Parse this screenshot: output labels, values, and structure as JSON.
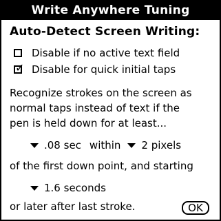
{
  "dialog": {
    "title": "Write Anywhere Tuning",
    "heading": "Auto-Detect Screen Writing:"
  },
  "checkboxes": [
    {
      "label": "Disable if no active text field",
      "checked": false
    },
    {
      "label": "Disable for quick initial taps",
      "checked": true,
      "mark": "✓"
    }
  ],
  "description": {
    "line1": "Recognize strokes on the screen as",
    "line2": "normal taps instead of text if the",
    "line3": "pen is held down for at least...",
    "line4": "of the first down point, and starting",
    "line5": "or later after last stroke."
  },
  "pickers": {
    "hold_time": ".08 sec",
    "within_label": "within",
    "distance": "2 pixels",
    "delay": "1.6 seconds"
  },
  "buttons": {
    "ok": "OK"
  }
}
